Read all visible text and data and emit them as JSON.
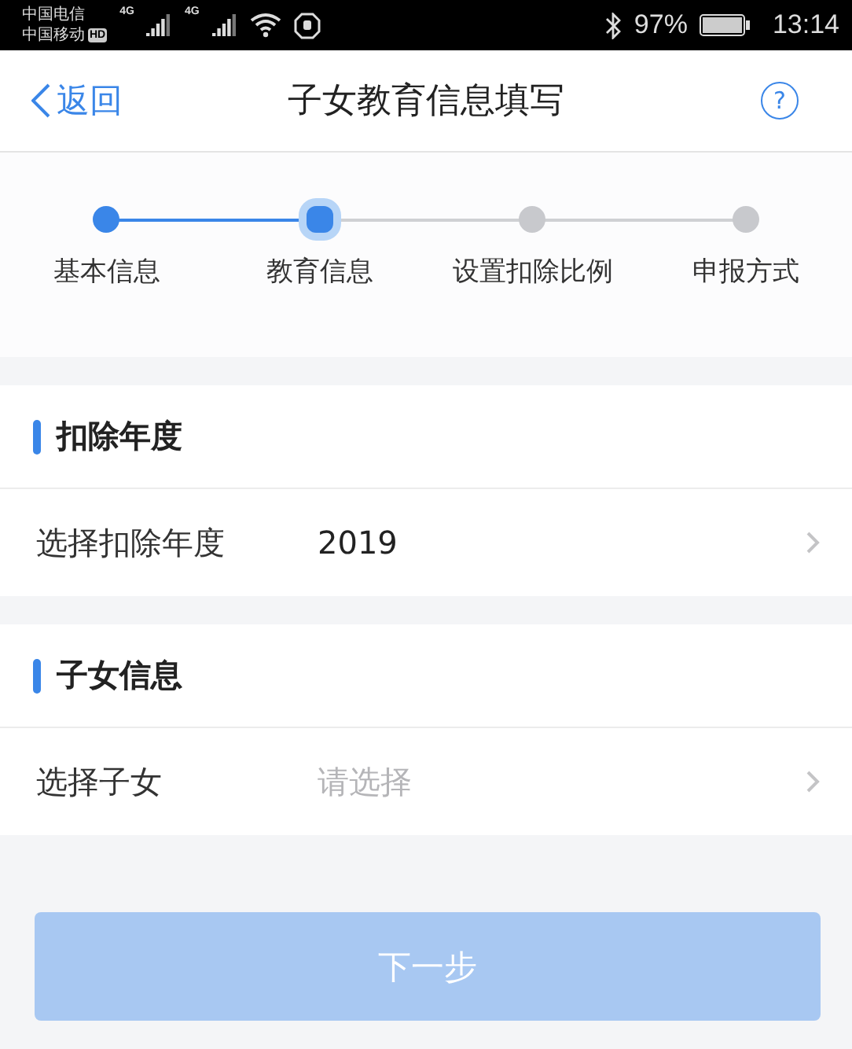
{
  "status_bar": {
    "carriers": [
      "中国电信",
      "中国移动"
    ],
    "hd_badge": "HD",
    "network_labels": [
      "4G",
      "4G"
    ],
    "battery_percent": "97%",
    "time": "13:14"
  },
  "nav_bar": {
    "back_label": "返回",
    "title": "子女教育信息填写",
    "help_label": "?"
  },
  "steps": [
    {
      "label": "基本信息",
      "completed": true,
      "selected": false
    },
    {
      "label": "教育信息",
      "completed": false,
      "selected": true
    },
    {
      "label": "设置扣除比例",
      "completed": false,
      "selected": false
    },
    {
      "label": "申报方式",
      "completed": false,
      "selected": false
    }
  ],
  "sections": [
    {
      "title": "扣除年度",
      "row": {
        "label": "选择扣除年度",
        "value": "2019"
      }
    },
    {
      "title": "子女信息",
      "row": {
        "label": "选择子女",
        "placeholder": "请选择"
      }
    }
  ],
  "next_button": {
    "label": "下一步",
    "disabled": true
  }
}
